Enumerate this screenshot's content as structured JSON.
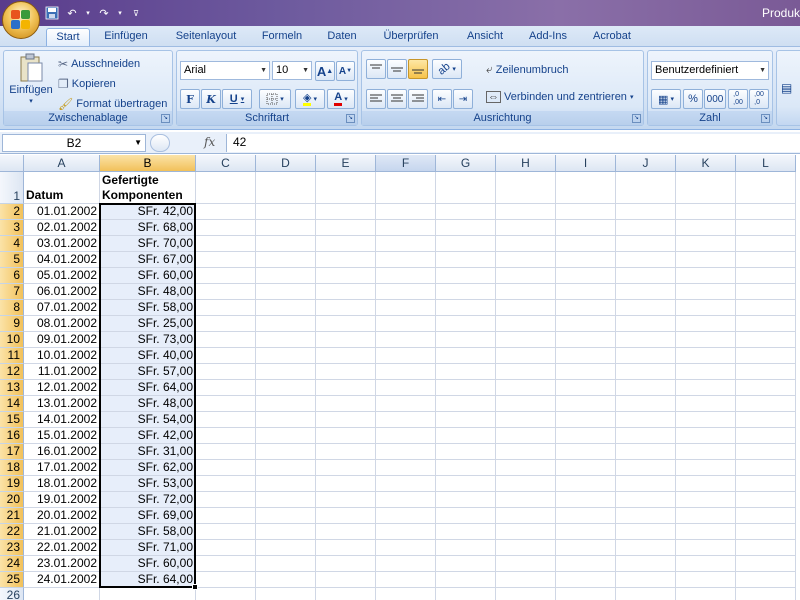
{
  "window": {
    "title": "Produk"
  },
  "ribbon_tabs": [
    {
      "label": "Start",
      "active": true
    },
    {
      "label": "Einfügen"
    },
    {
      "label": "Seitenlayout"
    },
    {
      "label": "Formeln"
    },
    {
      "label": "Daten"
    },
    {
      "label": "Überprüfen"
    },
    {
      "label": "Ansicht"
    },
    {
      "label": "Add-Ins"
    },
    {
      "label": "Acrobat"
    }
  ],
  "clipboard": {
    "group_label": "Zwischenablage",
    "paste_label": "Einfügen",
    "cut_label": "Ausschneiden",
    "copy_label": "Kopieren",
    "format_painter_label": "Format übertragen"
  },
  "font": {
    "group_label": "Schriftart",
    "font_name": "Arial",
    "font_size": "10",
    "bold_label": "F",
    "italic_label": "K",
    "underline_label": "U",
    "grow_label": "A",
    "shrink_label": "A",
    "color_label": "A"
  },
  "alignment": {
    "group_label": "Ausrichtung",
    "wrap_label": "Zeilenumbruch",
    "merge_label": "Verbinden und zentrieren"
  },
  "number": {
    "group_label": "Zahl",
    "format": "Benutzerdefiniert",
    "percent_label": "%",
    "thousands_label": "000",
    "inc_decimal": ",0→,00",
    "dec_decimal": ",00→,0"
  },
  "formula_bar": {
    "name_box": "B2",
    "fx_label": "fx",
    "value": "42"
  },
  "sheet": {
    "columns": [
      "A",
      "B",
      "C",
      "D",
      "E",
      "F",
      "G",
      "H",
      "I",
      "J",
      "K",
      "L"
    ],
    "selected_column": "B",
    "header_row": {
      "row": "1",
      "a": "Datum",
      "b_line1": "Gefertigte",
      "b_line2": "Komponenten"
    },
    "rows": [
      {
        "row": "2",
        "date": "01.01.2002",
        "value": "SFr. 42,00"
      },
      {
        "row": "3",
        "date": "02.01.2002",
        "value": "SFr. 68,00"
      },
      {
        "row": "4",
        "date": "03.01.2002",
        "value": "SFr. 70,00"
      },
      {
        "row": "5",
        "date": "04.01.2002",
        "value": "SFr. 67,00"
      },
      {
        "row": "6",
        "date": "05.01.2002",
        "value": "SFr. 60,00"
      },
      {
        "row": "7",
        "date": "06.01.2002",
        "value": "SFr. 48,00"
      },
      {
        "row": "8",
        "date": "07.01.2002",
        "value": "SFr. 58,00"
      },
      {
        "row": "9",
        "date": "08.01.2002",
        "value": "SFr. 25,00"
      },
      {
        "row": "10",
        "date": "09.01.2002",
        "value": "SFr. 73,00"
      },
      {
        "row": "11",
        "date": "10.01.2002",
        "value": "SFr. 40,00"
      },
      {
        "row": "12",
        "date": "11.01.2002",
        "value": "SFr. 57,00"
      },
      {
        "row": "13",
        "date": "12.01.2002",
        "value": "SFr. 64,00"
      },
      {
        "row": "14",
        "date": "13.01.2002",
        "value": "SFr. 48,00"
      },
      {
        "row": "15",
        "date": "14.01.2002",
        "value": "SFr. 54,00"
      },
      {
        "row": "16",
        "date": "15.01.2002",
        "value": "SFr. 42,00"
      },
      {
        "row": "17",
        "date": "16.01.2002",
        "value": "SFr. 31,00"
      },
      {
        "row": "18",
        "date": "17.01.2002",
        "value": "SFr. 62,00"
      },
      {
        "row": "19",
        "date": "18.01.2002",
        "value": "SFr. 53,00"
      },
      {
        "row": "20",
        "date": "19.01.2002",
        "value": "SFr. 72,00"
      },
      {
        "row": "21",
        "date": "20.01.2002",
        "value": "SFr. 69,00"
      },
      {
        "row": "22",
        "date": "21.01.2002",
        "value": "SFr. 58,00"
      },
      {
        "row": "23",
        "date": "22.01.2002",
        "value": "SFr. 71,00"
      },
      {
        "row": "24",
        "date": "23.01.2002",
        "value": "SFr. 60,00"
      },
      {
        "row": "25",
        "date": "24.01.2002",
        "value": "SFr. 64,00"
      },
      {
        "row": "26",
        "date": "",
        "value": ""
      }
    ]
  },
  "colors": {
    "accent": "#15428b",
    "selection_header": "#f2c15a",
    "titlebar": "#6d5a9e"
  }
}
